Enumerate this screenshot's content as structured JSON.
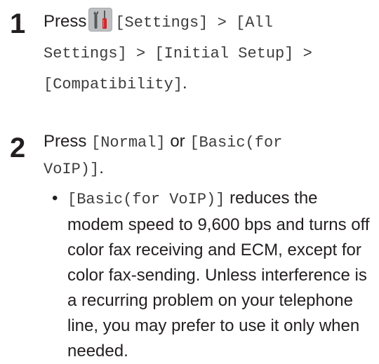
{
  "steps": [
    {
      "number": "1",
      "text_press": "Press",
      "icon": "settings-tools-icon",
      "path_part1": "[Settings] > [All",
      "path_part2": "Settings] > [Initial Setup] >",
      "path_part3": "[Compatibility]",
      "period": "."
    },
    {
      "number": "2",
      "text_press": "Press",
      "option_normal": "[Normal]",
      "text_or": "or",
      "option_basic_line1": "[Basic(for",
      "option_basic_line2": "VoIP)]",
      "period": "."
    }
  ],
  "bullet": {
    "marker": "•",
    "code": "[Basic(for VoIP)]",
    "text": "reduces the modem speed to 9,600 bps and turns off color fax receiving and ECM, except for color fax-sending. Unless interference is a recurring problem on your telephone line, you may prefer to use it only when needed."
  },
  "colors": {
    "icon_bg": "#a7a9ac",
    "screwdriver_red": "#d2232a",
    "text": "#231f20"
  }
}
